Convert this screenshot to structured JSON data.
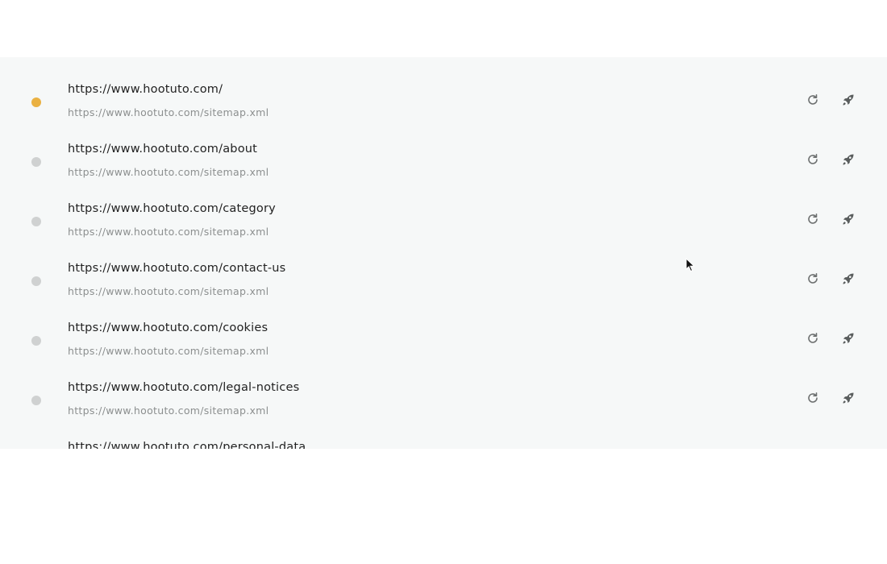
{
  "urls": [
    {
      "url": "https://www.hootuto.com/",
      "source": "https://www.hootuto.com/sitemap.xml",
      "status": "active"
    },
    {
      "url": "https://www.hootuto.com/about",
      "source": "https://www.hootuto.com/sitemap.xml",
      "status": "idle"
    },
    {
      "url": "https://www.hootuto.com/category",
      "source": "https://www.hootuto.com/sitemap.xml",
      "status": "idle"
    },
    {
      "url": "https://www.hootuto.com/contact-us",
      "source": "https://www.hootuto.com/sitemap.xml",
      "status": "idle"
    },
    {
      "url": "https://www.hootuto.com/cookies",
      "source": "https://www.hootuto.com/sitemap.xml",
      "status": "idle"
    },
    {
      "url": "https://www.hootuto.com/legal-notices",
      "source": "https://www.hootuto.com/sitemap.xml",
      "status": "idle"
    },
    {
      "url": "https://www.hootuto.com/personal-data",
      "source": "",
      "status": "idle"
    }
  ],
  "icons": {
    "refresh": "refresh-icon",
    "launch": "rocket-icon"
  },
  "colors": {
    "active_dot": "#eab142",
    "idle_dot": "#cfd1d1",
    "panel_bg": "#f6f8f8"
  }
}
